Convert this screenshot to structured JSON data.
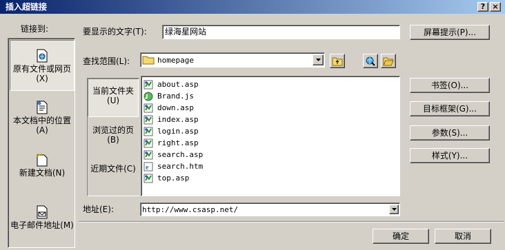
{
  "window": {
    "title": "插入超链接",
    "help_label": "?",
    "close_label": "×"
  },
  "link_to_label": "链接到:",
  "nav": [
    {
      "label": "原有文件或网页(X)",
      "icon": "web-page-icon",
      "selected": true
    },
    {
      "label": "本文档中的位置(A)",
      "icon": "document-place-icon",
      "selected": false
    },
    {
      "label": "新建文档(N)",
      "icon": "new-document-icon",
      "selected": false
    },
    {
      "label": "电子邮件地址(M)",
      "icon": "email-address-icon",
      "selected": false
    }
  ],
  "display_text": {
    "label": "要显示的文字(T):",
    "value": "绿海星网站"
  },
  "screen_tip_label": "屏幕提示(P)...",
  "look_in": {
    "label": "查找范围(L):",
    "value": "homepage"
  },
  "subnav": [
    {
      "label": "当前文件夹(U)",
      "selected": true
    },
    {
      "label": "浏览过的页(B)",
      "selected": false
    },
    {
      "label": "近期文件(C)",
      "selected": false
    }
  ],
  "files": [
    {
      "name": "about.asp",
      "icon": "asp-file-icon"
    },
    {
      "name": "Brand.js",
      "icon": "js-file-icon"
    },
    {
      "name": "down.asp",
      "icon": "asp-file-icon"
    },
    {
      "name": "index.asp",
      "icon": "asp-file-icon"
    },
    {
      "name": "login.asp",
      "icon": "asp-file-icon"
    },
    {
      "name": "right.asp",
      "icon": "asp-file-icon"
    },
    {
      "name": "search.asp",
      "icon": "asp-file-icon"
    },
    {
      "name": "search.htm",
      "icon": "html-file-icon"
    },
    {
      "name": "top.asp",
      "icon": "asp-file-icon"
    }
  ],
  "side_buttons": {
    "bookmark": "书签(O)...",
    "target_frame": "目标框架(G)...",
    "parameters": "参数(S)...",
    "style": "样式(Y)..."
  },
  "address": {
    "label": "地址(E):",
    "value": "http://www.csasp.net/"
  },
  "ok_label": "确定",
  "cancel_label": "取消",
  "colors": {
    "title_start": "#0a246a",
    "title_end": "#a6caf0",
    "face": "#d4d0c8"
  }
}
